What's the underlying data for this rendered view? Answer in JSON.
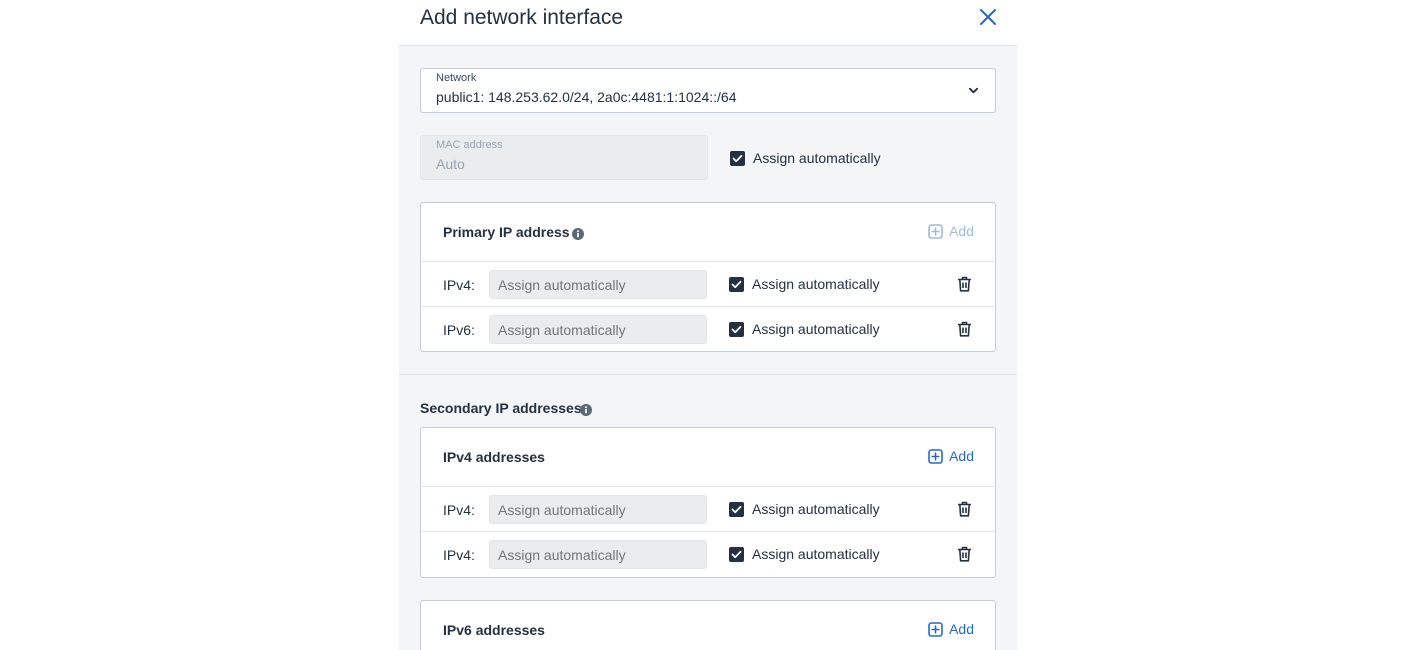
{
  "dialog": {
    "title": "Add network interface"
  },
  "network": {
    "label": "Network",
    "value": "public1: 148.253.62.0/24, 2a0c:4481:1:1024::/64"
  },
  "mac": {
    "label": "MAC address",
    "value": "Auto",
    "assign_label": "Assign automatically",
    "assign_checked": true
  },
  "primary": {
    "title": "Primary IP address",
    "add_label": "Add",
    "add_enabled": false,
    "rows": [
      {
        "label": "IPv4:",
        "placeholder": "Assign automatically",
        "check_label": "Assign automatically",
        "checked": true
      },
      {
        "label": "IPv6:",
        "placeholder": "Assign automatically",
        "check_label": "Assign automatically",
        "checked": true
      }
    ]
  },
  "secondary": {
    "title": "Secondary IP addresses",
    "ipv4": {
      "title": "IPv4 addresses",
      "add_label": "Add",
      "rows": [
        {
          "label": "IPv4:",
          "placeholder": "Assign automatically",
          "check_label": "Assign automatically",
          "checked": true
        },
        {
          "label": "IPv4:",
          "placeholder": "Assign automatically",
          "check_label": "Assign automatically",
          "checked": true
        }
      ]
    },
    "ipv6": {
      "title": "IPv6 addresses",
      "add_label": "Add"
    }
  },
  "icons": {
    "close": "close-icon",
    "dropdown": "chevron-down-icon",
    "info": "info-icon",
    "add": "plus-square-icon",
    "delete": "trash-icon",
    "check": "checkmark-icon"
  },
  "colors": {
    "accent": "#2668c5",
    "accent_disabled": "#9dbbe3",
    "text": "#243143",
    "placeholder": "#9aa3ad",
    "panel_bg": "#f4f5f7"
  }
}
